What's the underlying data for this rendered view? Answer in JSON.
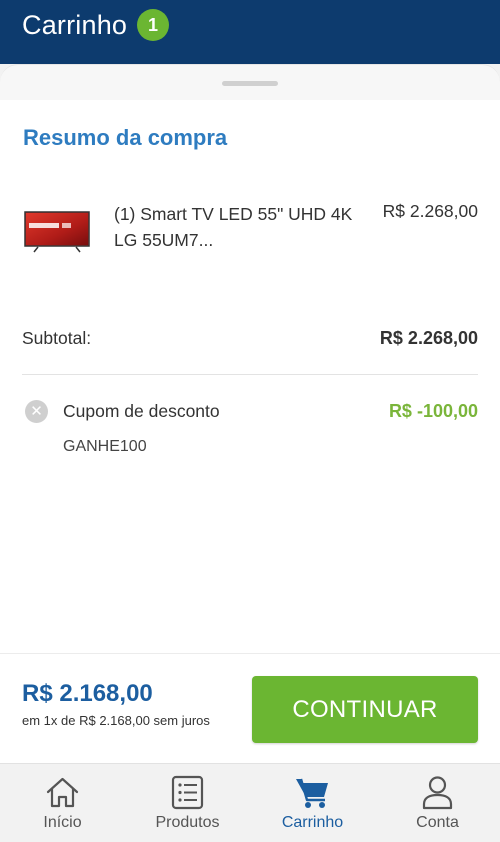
{
  "header": {
    "title": "Carrinho",
    "cart_count": "1"
  },
  "summary": {
    "title": "Resumo da compra",
    "product": {
      "thumbnail_icon": "lg-uhd-tv-thumbnail",
      "name": "(1) Smart TV LED 55\" UHD 4K LG 55UM7...",
      "price": "R$ 2.268,00"
    },
    "subtotal_label": "Subtotal:",
    "subtotal_value": "R$ 2.268,00",
    "coupon": {
      "label": "Cupom de desconto",
      "value": "R$ -100,00",
      "code": "GANHE100",
      "remove_icon": "close-icon"
    }
  },
  "checkout": {
    "total": "R$ 2.168,00",
    "installments": "em 1x de R$ 2.168,00 sem juros",
    "continue_label": "CONTINUAR"
  },
  "tabs": [
    {
      "label": "Início",
      "icon": "home-icon",
      "active": false
    },
    {
      "label": "Produtos",
      "icon": "list-icon",
      "active": false
    },
    {
      "label": "Carrinho",
      "icon": "cart-icon",
      "active": true
    },
    {
      "label": "Conta",
      "icon": "user-icon",
      "active": false
    }
  ],
  "colors": {
    "header_bg": "#0d3b6e",
    "accent_blue": "#2e7cc0",
    "total_blue": "#1c5ea0",
    "accent_green": "#6bb632",
    "discount_green": "#7ab53a"
  }
}
